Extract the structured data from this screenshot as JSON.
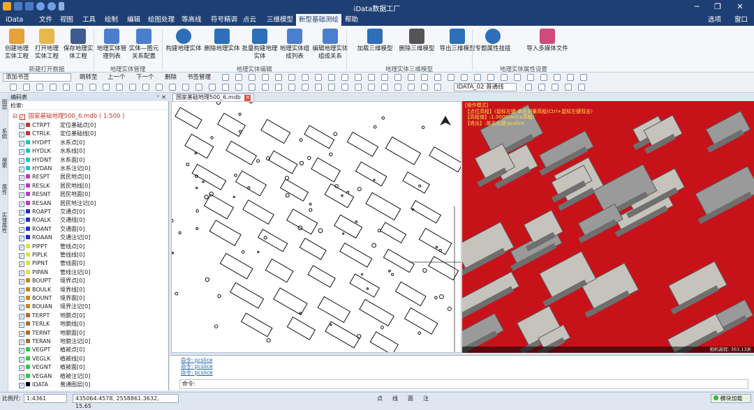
{
  "app": {
    "title": "iData数据工厂"
  },
  "window_controls": {
    "minimize": "─",
    "maximize": "❐",
    "close": "✕"
  },
  "menubar": {
    "items": [
      {
        "label": "iData"
      },
      {
        "label": "文件"
      },
      {
        "label": "视图"
      },
      {
        "label": "工具"
      },
      {
        "label": "绘制"
      },
      {
        "label": "编辑"
      },
      {
        "label": "绘图处理"
      },
      {
        "label": "等高线"
      },
      {
        "label": "符号精调"
      },
      {
        "label": "点云"
      },
      {
        "label": "三维模型"
      },
      {
        "label": "新型基础测绘"
      },
      {
        "label": "帮助"
      }
    ],
    "active_index": 11,
    "right_options": "选项",
    "right_window": "窗口"
  },
  "ribbon": {
    "buttons": [
      {
        "label": "创建地理实体工程",
        "icon": "create-project-icon"
      },
      {
        "label": "打开地理实体工程",
        "icon": "open-folder-icon"
      },
      {
        "label": "保存地理实体工程",
        "icon": "save-project-icon"
      },
      {
        "label": "地理实体管理列表",
        "icon": "entity-list-icon"
      },
      {
        "label": "实体—图元关系配置",
        "icon": "relation-config-icon"
      },
      {
        "label": "构建地理实体",
        "icon": "build-entity-icon"
      },
      {
        "label": "删除地理实体",
        "icon": "trash-icon"
      },
      {
        "label": "批量构建地理实体",
        "icon": "batch-build-icon"
      },
      {
        "label": "地理实体组成列表",
        "icon": "composition-list-icon"
      },
      {
        "label": "编辑地理实体组成关系",
        "icon": "edit-relation-icon"
      },
      {
        "label": "加载三维模型",
        "icon": "load-3d-icon"
      },
      {
        "label": "删除三维模型",
        "icon": "delete-3d-icon"
      },
      {
        "label": "导出三维模型",
        "icon": "export-3d-icon"
      },
      {
        "label": "专题属性挂接",
        "icon": "info-icon"
      },
      {
        "label": "导入多媒体文件",
        "icon": "media-import-icon"
      }
    ],
    "groups": [
      {
        "label": "新建打开数据"
      },
      {
        "label": "地理实体管理"
      },
      {
        "label": "地理实体编辑"
      },
      {
        "label": "地理实体三维模型"
      },
      {
        "label": "地理实体属性设置"
      }
    ]
  },
  "toolbar": {
    "bookmark_combo": "添加书签",
    "jump_to": "跳转至",
    "prev": "上一个",
    "next": "下一个",
    "delete": "删除",
    "bookmark_manage": "书签管理",
    "layer_combo": "IDATA_02 普通线"
  },
  "sidebar_tabs": [
    {
      "label": "图层"
    },
    {
      "label": "系统"
    },
    {
      "label": "搜索"
    },
    {
      "label": "属性"
    },
    {
      "label": "实体属性"
    }
  ],
  "layer_panel": {
    "title": "编码表",
    "search_label": "检索:",
    "root": "国家基础地理500_6.mdb ( 1:500 )",
    "layers": [
      {
        "code": "CTRPT",
        "name": "定位基础点[0]",
        "color": "#c0392b"
      },
      {
        "code": "CTRLK",
        "name": "定位基础线[0]",
        "color": "#c0392b"
      },
      {
        "code": "HYDPT",
        "name": "水系点[0]",
        "color": "#19c6c6"
      },
      {
        "code": "HYDLK",
        "name": "水系线[0]",
        "color": "#19c6c6"
      },
      {
        "code": "HYDNT",
        "name": "水系面[0]",
        "color": "#19c6c6"
      },
      {
        "code": "HYDAN",
        "name": "水系注记[0]",
        "color": "#19c6c6"
      },
      {
        "code": "RESPT",
        "name": "居民地点[0]",
        "color": "#c03ac0"
      },
      {
        "code": "RESLK",
        "name": "居民地线[0]",
        "color": "#c03ac0"
      },
      {
        "code": "RESNT",
        "name": "居民地面[0]",
        "color": "#c03ac0"
      },
      {
        "code": "RESAN",
        "name": "居民地注记[0]",
        "color": "#c03ac0"
      },
      {
        "code": "ROAPT",
        "name": "交通点[0]",
        "color": "#1d2fbf"
      },
      {
        "code": "ROALK",
        "name": "交通线[0]",
        "color": "#1d2fbf"
      },
      {
        "code": "ROANT",
        "name": "交通面[0]",
        "color": "#1d2fbf"
      },
      {
        "code": "ROAAN",
        "name": "交通注记[0]",
        "color": "#1d2fbf"
      },
      {
        "code": "PIPPT",
        "name": "管线点[0]",
        "color": "#d6e63a"
      },
      {
        "code": "PIPLK",
        "name": "管线线[0]",
        "color": "#d6e63a"
      },
      {
        "code": "PIPNT",
        "name": "管线面[0]",
        "color": "#d6e63a"
      },
      {
        "code": "PIPAN",
        "name": "管线注记[0]",
        "color": "#d6e63a"
      },
      {
        "code": "BOUPT",
        "name": "境界点[0]",
        "color": "#c8861b"
      },
      {
        "code": "BOULK",
        "name": "境界线[0]",
        "color": "#c8861b"
      },
      {
        "code": "BOUNT",
        "name": "境界面[0]",
        "color": "#c8861b"
      },
      {
        "code": "BOUAN",
        "name": "境界注记[0]",
        "color": "#c8861b"
      },
      {
        "code": "TERPT",
        "name": "地貌点[0]",
        "color": "#b06a2a"
      },
      {
        "code": "TERLK",
        "name": "地貌线[0]",
        "color": "#b06a2a"
      },
      {
        "code": "TERNT",
        "name": "地貌面[0]",
        "color": "#b06a2a"
      },
      {
        "code": "TERAN",
        "name": "地貌注记[0]",
        "color": "#b06a2a"
      },
      {
        "code": "VEGPT",
        "name": "植被点[0]",
        "color": "#2ecc40"
      },
      {
        "code": "VEGLK",
        "name": "植被线[0]",
        "color": "#2ecc40"
      },
      {
        "code": "VEGNT",
        "name": "植被面[0]",
        "color": "#2ecc40"
      },
      {
        "code": "VEGAN",
        "name": "植被注记[0]",
        "color": "#2ecc40"
      },
      {
        "code": "IDATA",
        "name": "普通图层[0]",
        "color": "#000000"
      }
    ]
  },
  "document_tab": {
    "label": "国家基础地理500_6.mdb"
  },
  "view3d_overlay": {
    "line1": "[操作模式]",
    "line2": "【点位高程】(鼠标左键:单击测量高程(Ctrl+鼠标左键双击)",
    "line3": "【高程值】:1.0000(m)(±高程)",
    "line4": "【退出】:单击右键:pcslice",
    "scale": "相机高程: 363.13米"
  },
  "command": {
    "lines": [
      "命令: pcslice",
      "命令: pcslice",
      "命令: pcslice"
    ],
    "prompt": "命令:"
  },
  "statusbar": {
    "scale_label": "比例尺:",
    "scale_value": "1:4361",
    "coords": "435064.4578, 2558861.3632, 15.65",
    "snap_modes": [
      "点",
      "线",
      "面",
      "注"
    ],
    "right_status": "模块加载"
  }
}
